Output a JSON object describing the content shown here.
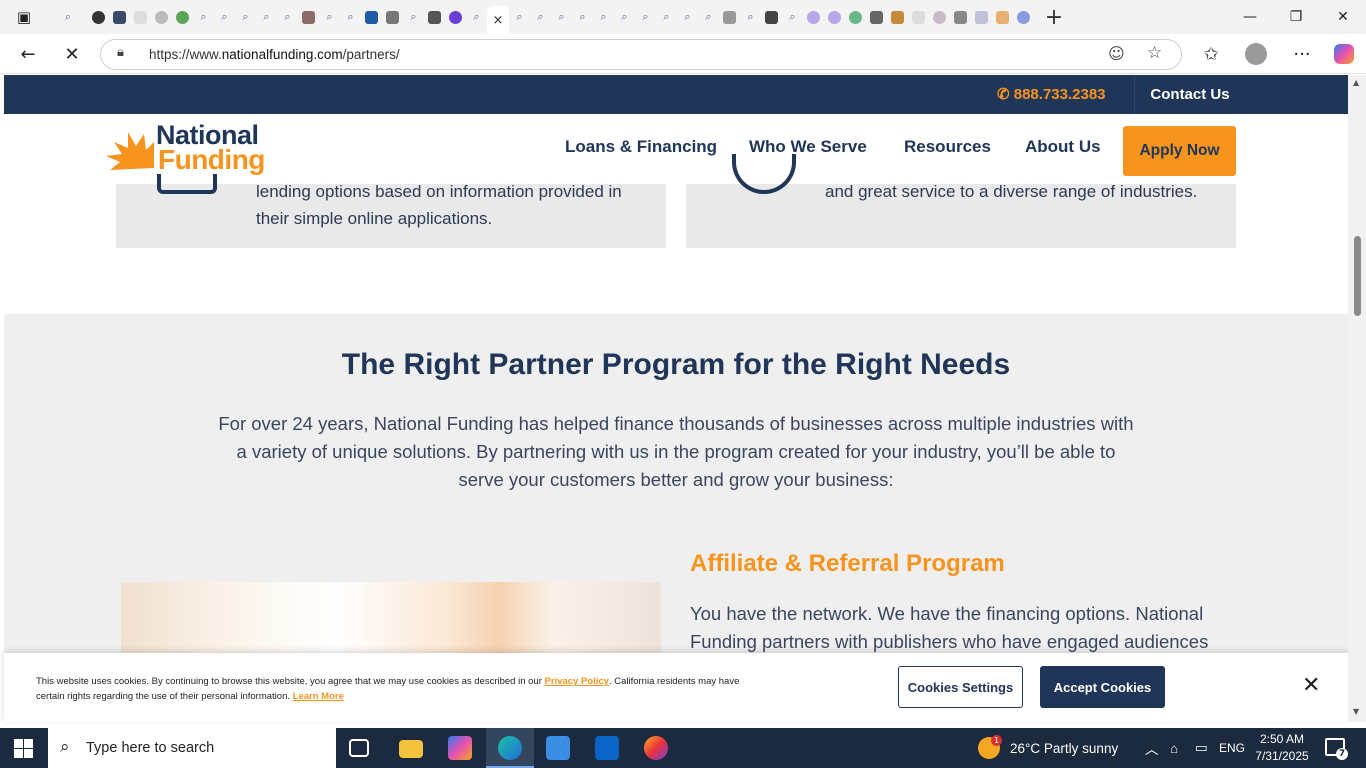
{
  "browser": {
    "url_prefix": "https://www.",
    "url_domain": "nationalfunding.com",
    "url_path": "/partners/",
    "tab_close": "×",
    "new_tab": "+",
    "win_min": "—",
    "win_max": "❐",
    "win_close": "✕",
    "more": "···"
  },
  "site": {
    "phone": "888.733.2383",
    "contact": "Contact Us",
    "logo_top": "National",
    "logo_bottom": "Funding",
    "nav": [
      "Loans & Financing",
      "Who We Serve",
      "Resources",
      "About Us"
    ],
    "apply": "Apply Now",
    "card_left_line1": "lending options based on information provided in",
    "card_left_line2": "their simple online applications.",
    "card_right_line1": "and great service to a diverse range of industries.",
    "section_title": "The Right Partner Program for the Right Needs",
    "intro": "For over 24 years, National Funding has helped finance thousands of businesses across multiple industries with a variety of unique solutions. By partnering with us in the program created for your industry, you’ll be able to serve your customers better and grow your business:",
    "program_title": "Affiliate & Referral Program",
    "program_text": "You have the network. We have the financing options. National Funding partners with publishers who have engaged audiences"
  },
  "cookie": {
    "text1": "This website uses cookies. By continuing to browse this website, you agree that we may use cookies as described in our",
    "privacy": "Privacy Policy",
    "text2": ". California residents may have certain rights regarding the use of their personal information.",
    "learn": "Learn More",
    "settings": "Cookies Settings",
    "accept": "Accept Cookies",
    "close": "✕"
  },
  "taskbar": {
    "search_placeholder": "Type here to search",
    "weather": "26°C  Partly sunny",
    "lang": "ENG",
    "time": "2:50 AM",
    "date": "7/31/2025",
    "notif": "7",
    "weather_badge": "1"
  }
}
